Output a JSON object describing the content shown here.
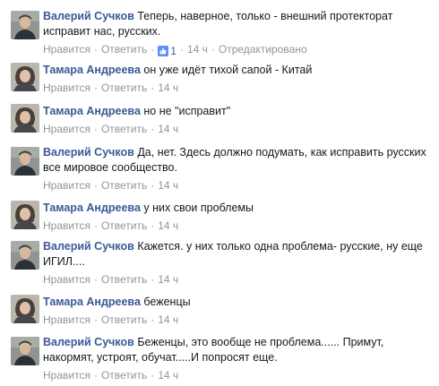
{
  "actions": {
    "like": "Нравится",
    "reply": "Ответить",
    "dot": "·"
  },
  "comments": [
    {
      "author": "Валерий Сучков",
      "text": "Теперь, наверное, только - внешний протекторат исправит нас, русских.",
      "likes": "1",
      "time": "14 ч",
      "edited": "Отредактировано"
    },
    {
      "author": "Тамара Андреева",
      "text": "он уже идёт тихой сапой - Китай",
      "time": "14 ч"
    },
    {
      "author": "Тамара Андреева",
      "text": "но не \"исправит\"",
      "time": "14 ч"
    },
    {
      "author": "Валерий Сучков",
      "text": "Да, нет. Здесь должно подумать, как исправить русских все мировое сообщество.",
      "time": "14 ч"
    },
    {
      "author": "Тамара Андреева",
      "text": "у них свои проблемы",
      "time": "14 ч"
    },
    {
      "author": "Валерий Сучков",
      "text": "Кажется. у них только одна проблема- русские, ну еще ИГИЛ....",
      "time": "14 ч"
    },
    {
      "author": "Тамара Андреева",
      "text": "беженцы",
      "time": "14 ч"
    },
    {
      "author": "Валерий Сучков",
      "text": "Беженцы, это вообще не проблема...... Примут, накормят, устроят, обучат.....И попросят еще.",
      "time": "14 ч"
    }
  ],
  "colors": {
    "author_link": "#3b5998",
    "meta_gray": "#90949c",
    "like_badge": "#5890ff"
  }
}
